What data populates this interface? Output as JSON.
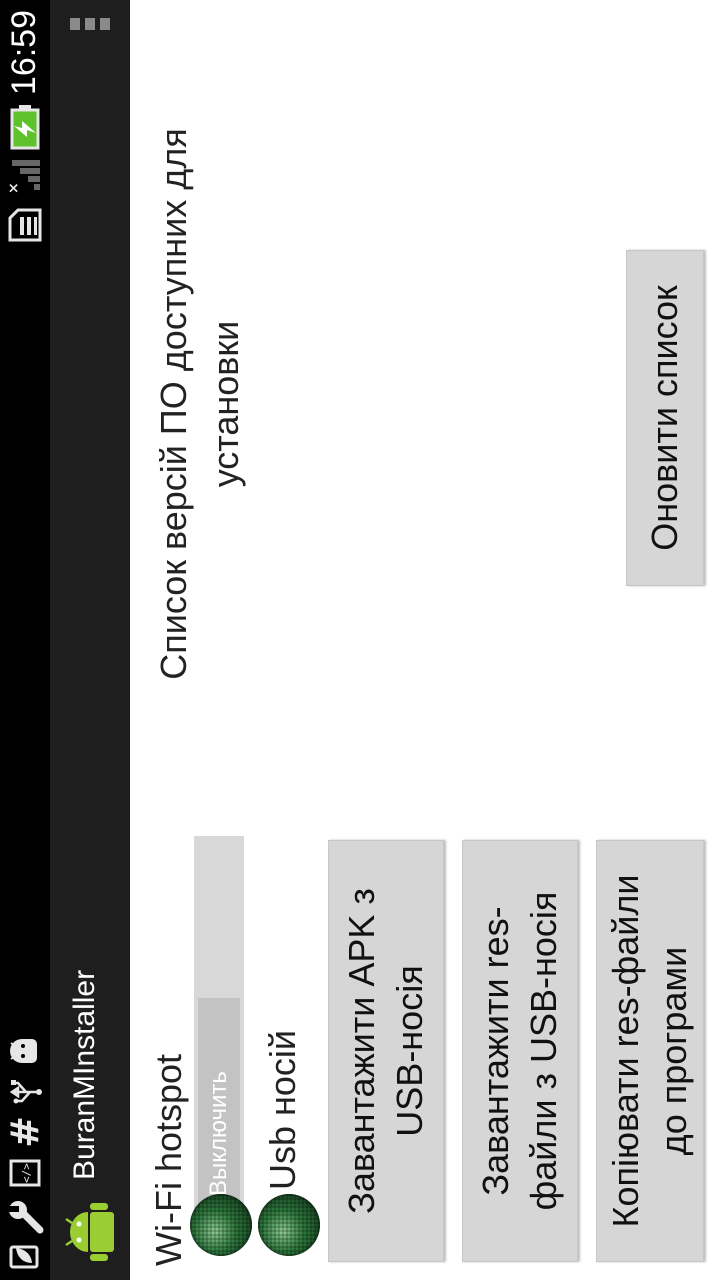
{
  "status_bar": {
    "time": "16:59",
    "icons": [
      "leaf-icon",
      "wrench-icon",
      "code-icon",
      "hash-icon",
      "usb-icon",
      "android-debug-icon",
      "sim-icon",
      "signal-icon",
      "battery-charging-icon"
    ]
  },
  "action_bar": {
    "title": "BuranMInstaller",
    "app_icon": "android-icon",
    "menu_icon": "overflow-menu-icon"
  },
  "wifi": {
    "label": "Wi-Fi hotspot",
    "toggle_label": "Выключить"
  },
  "usb": {
    "label": "Usb носій"
  },
  "buttons": {
    "load_apk": "Завантажити APK з USB-носія",
    "load_res": "Завантажити res-файли з USB-носія",
    "copy_res": "Копіювати res-файли до програми",
    "refresh_list": "Оновити список"
  },
  "versions": {
    "title": "Список версій ПО доступних для установки"
  },
  "colors": {
    "status_bar": "#000000",
    "action_bar": "#1e1e1e",
    "button": "#d6d6d6",
    "led_green": "#2e7a3e",
    "battery": "#5ec32a"
  }
}
